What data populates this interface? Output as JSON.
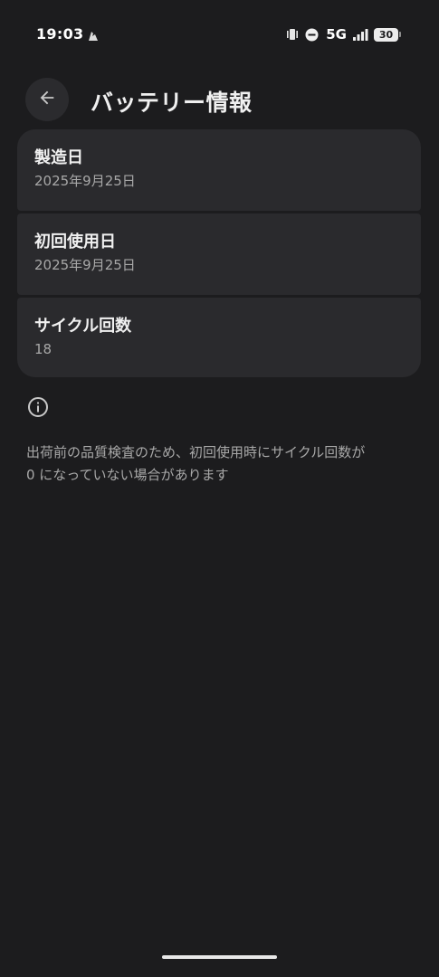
{
  "status_bar": {
    "time": "19:03",
    "network": "5G",
    "battery_level": "30"
  },
  "app_bar": {
    "title": "バッテリー情報"
  },
  "battery_info": {
    "items": [
      {
        "title": "製造日",
        "value": "2025年9月25日"
      },
      {
        "title": "初回使用日",
        "value": "2025年9月25日"
      },
      {
        "title": "サイクル回数",
        "value": "18"
      }
    ]
  },
  "note": {
    "line1": "出荷前の品質検査のため、初回使用時にサイクル回数が",
    "line2": "0 になっていない場合があります"
  },
  "icons": {
    "back": "arrow-left-icon",
    "info": "info-icon",
    "vibrate": "vibrate-icon",
    "dnd": "do-not-disturb-icon",
    "signal": "signal-icon",
    "notification": "notification-icon"
  },
  "colors": {
    "background": "#1c1c1e",
    "card": "#2a2a2d",
    "primary_text": "#f0f0f0",
    "secondary_text": "#a8a8a8"
  }
}
